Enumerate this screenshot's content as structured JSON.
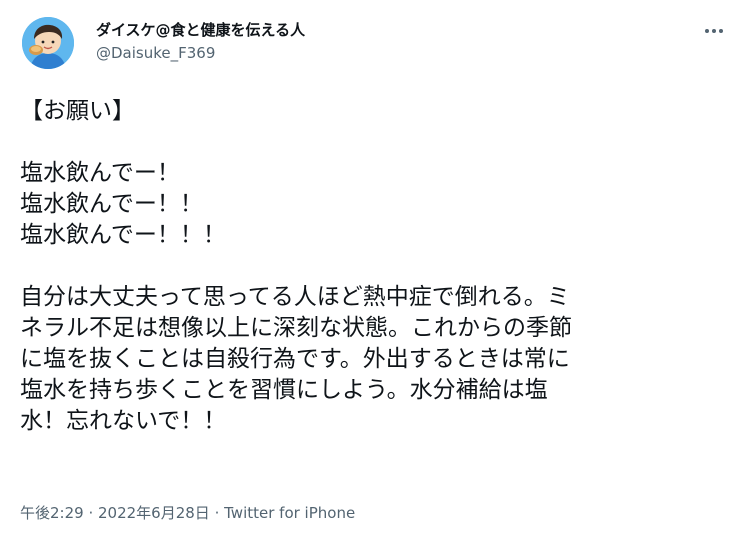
{
  "user": {
    "display_name": "ダイスケ@食と健康を伝える人",
    "handle": "@Daisuke_F369"
  },
  "more_icon": "more-horizontal-icon",
  "tweet": {
    "lines": [
      "【お願い】",
      "",
      "塩水飲んでー！",
      "塩水飲んでー！！",
      "塩水飲んでー！！！",
      "",
      "自分は大丈夫って思ってる人ほど熱中症で倒れる。ミ",
      "ネラル不足は想像以上に深刻な状態。これからの季節",
      "に塩を抜くことは自殺行為です。外出するときは常に",
      "塩水を持ち歩くことを習慣にしよう。水分補給は塩",
      "水！忘れないで！！"
    ]
  },
  "meta": {
    "time": "午後2:29",
    "separator": " · ",
    "date": "2022年6月28日",
    "source": "Twitter for iPhone"
  },
  "colors": {
    "text": "#0f1419",
    "secondary": "#536471",
    "avatar_bg": "#5fb7ee"
  }
}
